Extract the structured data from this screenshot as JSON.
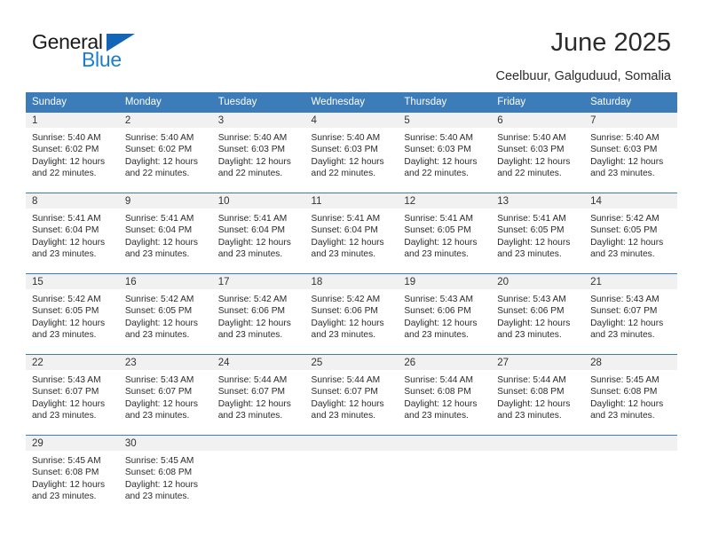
{
  "brand": {
    "name_top": "General",
    "name_bottom": "Blue",
    "accent_color": "#1b7ed0",
    "triangle_color": "#1565b6"
  },
  "header": {
    "title": "June 2025",
    "subtitle": "Ceelbuur, Galguduud, Somalia"
  },
  "calendar": {
    "header_bg": "#3b7cb9",
    "daynum_bg": "#f1f1f1",
    "weekday_headers": [
      "Sunday",
      "Monday",
      "Tuesday",
      "Wednesday",
      "Thursday",
      "Friday",
      "Saturday"
    ],
    "weeks": [
      [
        {
          "day": "1",
          "sunrise": "Sunrise: 5:40 AM",
          "sunset": "Sunset: 6:02 PM",
          "daylight_1": "Daylight: 12 hours",
          "daylight_2": "and 22 minutes."
        },
        {
          "day": "2",
          "sunrise": "Sunrise: 5:40 AM",
          "sunset": "Sunset: 6:02 PM",
          "daylight_1": "Daylight: 12 hours",
          "daylight_2": "and 22 minutes."
        },
        {
          "day": "3",
          "sunrise": "Sunrise: 5:40 AM",
          "sunset": "Sunset: 6:03 PM",
          "daylight_1": "Daylight: 12 hours",
          "daylight_2": "and 22 minutes."
        },
        {
          "day": "4",
          "sunrise": "Sunrise: 5:40 AM",
          "sunset": "Sunset: 6:03 PM",
          "daylight_1": "Daylight: 12 hours",
          "daylight_2": "and 22 minutes."
        },
        {
          "day": "5",
          "sunrise": "Sunrise: 5:40 AM",
          "sunset": "Sunset: 6:03 PM",
          "daylight_1": "Daylight: 12 hours",
          "daylight_2": "and 22 minutes."
        },
        {
          "day": "6",
          "sunrise": "Sunrise: 5:40 AM",
          "sunset": "Sunset: 6:03 PM",
          "daylight_1": "Daylight: 12 hours",
          "daylight_2": "and 22 minutes."
        },
        {
          "day": "7",
          "sunrise": "Sunrise: 5:40 AM",
          "sunset": "Sunset: 6:03 PM",
          "daylight_1": "Daylight: 12 hours",
          "daylight_2": "and 23 minutes."
        }
      ],
      [
        {
          "day": "8",
          "sunrise": "Sunrise: 5:41 AM",
          "sunset": "Sunset: 6:04 PM",
          "daylight_1": "Daylight: 12 hours",
          "daylight_2": "and 23 minutes."
        },
        {
          "day": "9",
          "sunrise": "Sunrise: 5:41 AM",
          "sunset": "Sunset: 6:04 PM",
          "daylight_1": "Daylight: 12 hours",
          "daylight_2": "and 23 minutes."
        },
        {
          "day": "10",
          "sunrise": "Sunrise: 5:41 AM",
          "sunset": "Sunset: 6:04 PM",
          "daylight_1": "Daylight: 12 hours",
          "daylight_2": "and 23 minutes."
        },
        {
          "day": "11",
          "sunrise": "Sunrise: 5:41 AM",
          "sunset": "Sunset: 6:04 PM",
          "daylight_1": "Daylight: 12 hours",
          "daylight_2": "and 23 minutes."
        },
        {
          "day": "12",
          "sunrise": "Sunrise: 5:41 AM",
          "sunset": "Sunset: 6:05 PM",
          "daylight_1": "Daylight: 12 hours",
          "daylight_2": "and 23 minutes."
        },
        {
          "day": "13",
          "sunrise": "Sunrise: 5:41 AM",
          "sunset": "Sunset: 6:05 PM",
          "daylight_1": "Daylight: 12 hours",
          "daylight_2": "and 23 minutes."
        },
        {
          "day": "14",
          "sunrise": "Sunrise: 5:42 AM",
          "sunset": "Sunset: 6:05 PM",
          "daylight_1": "Daylight: 12 hours",
          "daylight_2": "and 23 minutes."
        }
      ],
      [
        {
          "day": "15",
          "sunrise": "Sunrise: 5:42 AM",
          "sunset": "Sunset: 6:05 PM",
          "daylight_1": "Daylight: 12 hours",
          "daylight_2": "and 23 minutes."
        },
        {
          "day": "16",
          "sunrise": "Sunrise: 5:42 AM",
          "sunset": "Sunset: 6:05 PM",
          "daylight_1": "Daylight: 12 hours",
          "daylight_2": "and 23 minutes."
        },
        {
          "day": "17",
          "sunrise": "Sunrise: 5:42 AM",
          "sunset": "Sunset: 6:06 PM",
          "daylight_1": "Daylight: 12 hours",
          "daylight_2": "and 23 minutes."
        },
        {
          "day": "18",
          "sunrise": "Sunrise: 5:42 AM",
          "sunset": "Sunset: 6:06 PM",
          "daylight_1": "Daylight: 12 hours",
          "daylight_2": "and 23 minutes."
        },
        {
          "day": "19",
          "sunrise": "Sunrise: 5:43 AM",
          "sunset": "Sunset: 6:06 PM",
          "daylight_1": "Daylight: 12 hours",
          "daylight_2": "and 23 minutes."
        },
        {
          "day": "20",
          "sunrise": "Sunrise: 5:43 AM",
          "sunset": "Sunset: 6:06 PM",
          "daylight_1": "Daylight: 12 hours",
          "daylight_2": "and 23 minutes."
        },
        {
          "day": "21",
          "sunrise": "Sunrise: 5:43 AM",
          "sunset": "Sunset: 6:07 PM",
          "daylight_1": "Daylight: 12 hours",
          "daylight_2": "and 23 minutes."
        }
      ],
      [
        {
          "day": "22",
          "sunrise": "Sunrise: 5:43 AM",
          "sunset": "Sunset: 6:07 PM",
          "daylight_1": "Daylight: 12 hours",
          "daylight_2": "and 23 minutes."
        },
        {
          "day": "23",
          "sunrise": "Sunrise: 5:43 AM",
          "sunset": "Sunset: 6:07 PM",
          "daylight_1": "Daylight: 12 hours",
          "daylight_2": "and 23 minutes."
        },
        {
          "day": "24",
          "sunrise": "Sunrise: 5:44 AM",
          "sunset": "Sunset: 6:07 PM",
          "daylight_1": "Daylight: 12 hours",
          "daylight_2": "and 23 minutes."
        },
        {
          "day": "25",
          "sunrise": "Sunrise: 5:44 AM",
          "sunset": "Sunset: 6:07 PM",
          "daylight_1": "Daylight: 12 hours",
          "daylight_2": "and 23 minutes."
        },
        {
          "day": "26",
          "sunrise": "Sunrise: 5:44 AM",
          "sunset": "Sunset: 6:08 PM",
          "daylight_1": "Daylight: 12 hours",
          "daylight_2": "and 23 minutes."
        },
        {
          "day": "27",
          "sunrise": "Sunrise: 5:44 AM",
          "sunset": "Sunset: 6:08 PM",
          "daylight_1": "Daylight: 12 hours",
          "daylight_2": "and 23 minutes."
        },
        {
          "day": "28",
          "sunrise": "Sunrise: 5:45 AM",
          "sunset": "Sunset: 6:08 PM",
          "daylight_1": "Daylight: 12 hours",
          "daylight_2": "and 23 minutes."
        }
      ],
      [
        {
          "day": "29",
          "sunrise": "Sunrise: 5:45 AM",
          "sunset": "Sunset: 6:08 PM",
          "daylight_1": "Daylight: 12 hours",
          "daylight_2": "and 23 minutes."
        },
        {
          "day": "30",
          "sunrise": "Sunrise: 5:45 AM",
          "sunset": "Sunset: 6:08 PM",
          "daylight_1": "Daylight: 12 hours",
          "daylight_2": "and 23 minutes."
        },
        {
          "day": "",
          "sunrise": "",
          "sunset": "",
          "daylight_1": "",
          "daylight_2": ""
        },
        {
          "day": "",
          "sunrise": "",
          "sunset": "",
          "daylight_1": "",
          "daylight_2": ""
        },
        {
          "day": "",
          "sunrise": "",
          "sunset": "",
          "daylight_1": "",
          "daylight_2": ""
        },
        {
          "day": "",
          "sunrise": "",
          "sunset": "",
          "daylight_1": "",
          "daylight_2": ""
        },
        {
          "day": "",
          "sunrise": "",
          "sunset": "",
          "daylight_1": "",
          "daylight_2": ""
        }
      ]
    ]
  }
}
